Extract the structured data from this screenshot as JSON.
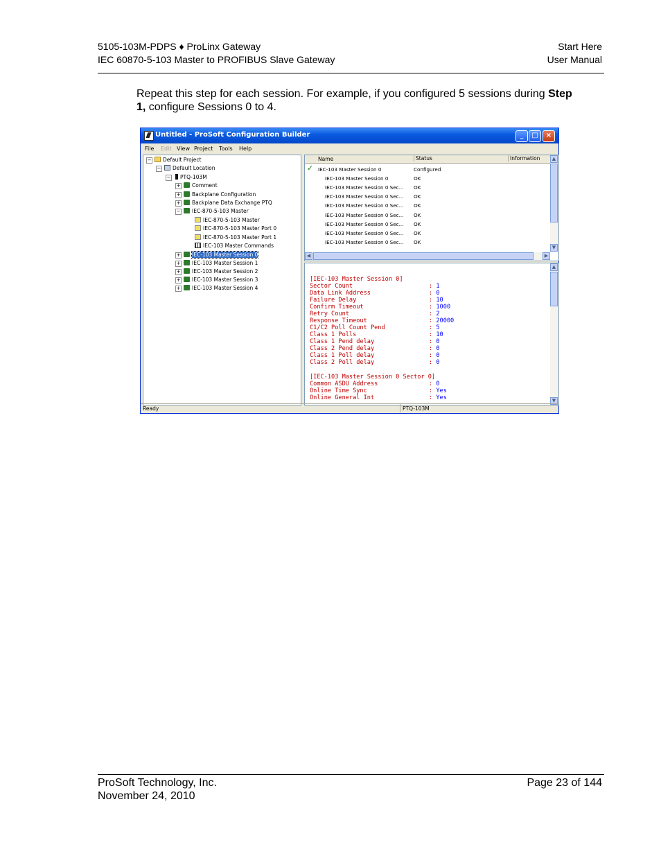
{
  "header": {
    "left_line1": "5105-103M-PDPS ♦ ProLinx Gateway",
    "left_line2": "IEC 60870-5-103 Master to PROFIBUS Slave Gateway",
    "right_line1": "Start Here",
    "right_line2": "User Manual"
  },
  "body": {
    "para_part1": "Repeat this step for each session. For example, if you configured 5 sessions during ",
    "para_bold": "Step 1,",
    "para_part2": " configure Sessions 0 to 4."
  },
  "window": {
    "title": "Untitled - ProSoft Configuration Builder",
    "menu": [
      "File",
      "Edit",
      "View",
      "Project",
      "Tools",
      "Help"
    ],
    "tree": [
      {
        "label": "Default Project",
        "icon": "folder-icon"
      },
      {
        "label": "Default Location",
        "icon": "location-icon"
      },
      {
        "label": "PTQ-103M",
        "icon": "device-icon"
      },
      {
        "label": "Comment",
        "icon": "network-icon"
      },
      {
        "label": "Backplane Configuration",
        "icon": "network-icon"
      },
      {
        "label": "Backplane Data Exchange PTQ",
        "icon": "network-icon"
      },
      {
        "label": "IEC-870-5-103 Master",
        "icon": "network-icon"
      },
      {
        "label": "IEC-870-5-103 Master",
        "icon": "document-icon"
      },
      {
        "label": "IEC-870-5-103 Master Port 0",
        "icon": "document-icon"
      },
      {
        "label": "IEC-870-5-103 Master Port 1",
        "icon": "document-icon"
      },
      {
        "label": "IEC-103 Master Commands",
        "icon": "grid-icon"
      },
      {
        "label": "IEC-103 Master Session 0",
        "icon": "network-icon"
      },
      {
        "label": "IEC-103 Master Session 1",
        "icon": "network-icon"
      },
      {
        "label": "IEC-103 Master Session 2",
        "icon": "network-icon"
      },
      {
        "label": "IEC-103 Master Session 3",
        "icon": "network-icon"
      },
      {
        "label": "IEC-103 Master Session 4",
        "icon": "network-icon"
      }
    ],
    "list_columns": [
      "Name",
      "Status",
      "Information"
    ],
    "list_rows": [
      {
        "name": "IEC-103 Master Session 0",
        "status": "Configured"
      },
      {
        "name": "IEC-103 Master Session 0",
        "status": "OK"
      },
      {
        "name": "IEC-103 Master Session 0 Sec...",
        "status": "OK"
      },
      {
        "name": "IEC-103 Master Session 0 Sec...",
        "status": "OK"
      },
      {
        "name": "IEC-103 Master Session 0 Sec...",
        "status": "OK"
      },
      {
        "name": "IEC-103 Master Session 0 Sec...",
        "status": "OK"
      },
      {
        "name": "IEC-103 Master Session 0 Sec...",
        "status": "OK"
      },
      {
        "name": "IEC-103 Master Session 0 Sec...",
        "status": "OK"
      },
      {
        "name": "IEC-103 Master Session 0 Sec...",
        "status": "OK"
      }
    ],
    "config_section1": "[IEC-103 Master Session 0]",
    "config_items1": [
      {
        "key": "Sector Count",
        "value": "1"
      },
      {
        "key": "Data Link Address",
        "value": "0"
      },
      {
        "key": "Failure Delay",
        "value": "10"
      },
      {
        "key": "Confirm Timeout",
        "value": "1000"
      },
      {
        "key": "Retry Count",
        "value": "2"
      },
      {
        "key": "Response Timeout",
        "value": "20000"
      },
      {
        "key": "C1/C2 Poll Count Pend",
        "value": "5"
      },
      {
        "key": "Class 1 Polls",
        "value": "10"
      },
      {
        "key": "Class 1 Pend delay",
        "value": "0"
      },
      {
        "key": "Class 2 Pend delay",
        "value": "0"
      },
      {
        "key": "Class 1 Poll delay",
        "value": "0"
      },
      {
        "key": "Class 2 Poll delay",
        "value": "0"
      }
    ],
    "config_section2": "[IEC-103 Master Session 0 Sector 0]",
    "config_items2": [
      {
        "key": "Common ASDU Address",
        "value": "0"
      },
      {
        "key": "Online Time Sync",
        "value": "Yes"
      },
      {
        "key": "Online General Int",
        "value": "Yes"
      }
    ],
    "status_left": "Ready",
    "status_right": "PTQ-103M"
  },
  "footer": {
    "left_line1": "ProSoft Technology, Inc.",
    "left_line2": "November 24, 2010",
    "right_line1": "Page 23 of 144"
  }
}
